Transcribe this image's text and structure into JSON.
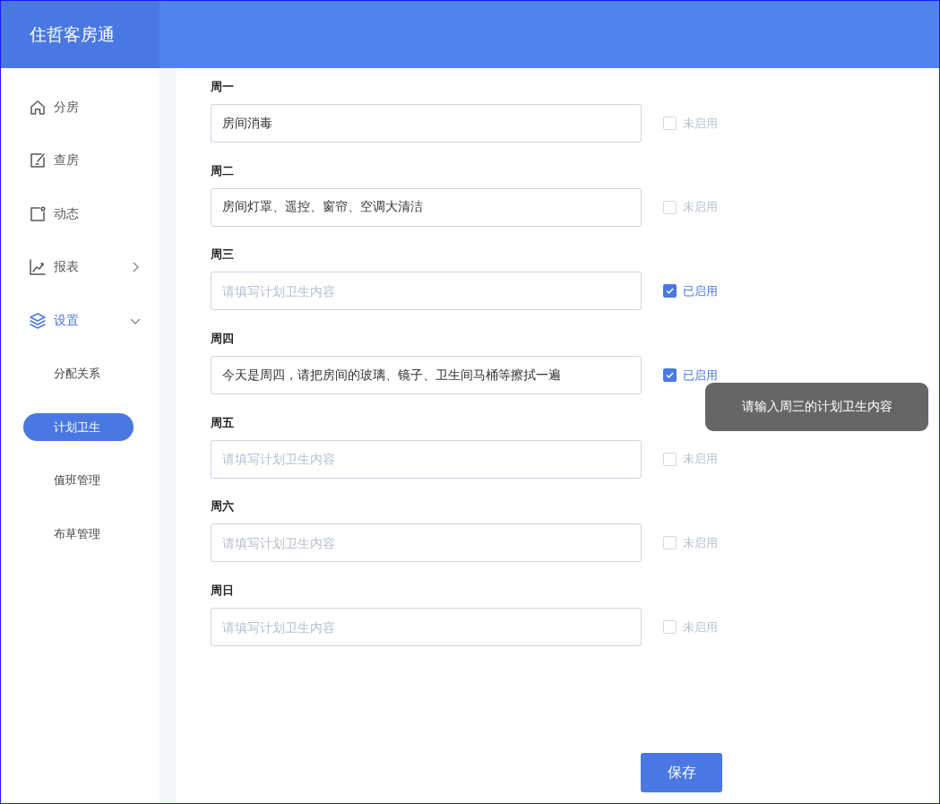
{
  "app": {
    "title": "住哲客房通"
  },
  "sidebar": {
    "items": [
      {
        "label": "分房",
        "selected": false
      },
      {
        "label": "查房",
        "selected": false
      },
      {
        "label": "动态",
        "selected": false
      },
      {
        "label": "报表",
        "selected": false,
        "expanded": false
      },
      {
        "label": "设置",
        "selected": true,
        "expanded": true,
        "children": [
          {
            "label": "分配关系",
            "selected": false
          },
          {
            "label": "计划卫生",
            "selected": true
          },
          {
            "label": "值班管理",
            "selected": false
          },
          {
            "label": "布草管理",
            "selected": false
          }
        ]
      }
    ]
  },
  "plan": {
    "days": [
      {
        "label": "周一",
        "value": "房间消毒",
        "checked": false,
        "status": "未启用"
      },
      {
        "label": "周二",
        "value": "房间灯罩、遥控、窗帘、空调大清洁",
        "checked": false,
        "status": "未启用"
      },
      {
        "label": "周三",
        "placeholder": "请填写计划卫生内容",
        "checked": true,
        "status": "已启用"
      },
      {
        "label": "周四",
        "value": "今天是周四，请把房间的玻璃、镜子、卫生间马桶等擦拭一遍",
        "checked": true,
        "status": "已启用"
      },
      {
        "label": "周五",
        "placeholder": "请填写计划卫生内容",
        "checked": false,
        "status": "未启用"
      },
      {
        "label": "周六",
        "placeholder": "请填写计划卫生内容",
        "checked": false,
        "status": "未启用"
      },
      {
        "label": "周日",
        "placeholder": "请填写计划卫生内容",
        "checked": false,
        "status": "未启用"
      }
    ],
    "save_button": "保存"
  },
  "toast": {
    "text": "请输入周三的计划卫生内容"
  }
}
